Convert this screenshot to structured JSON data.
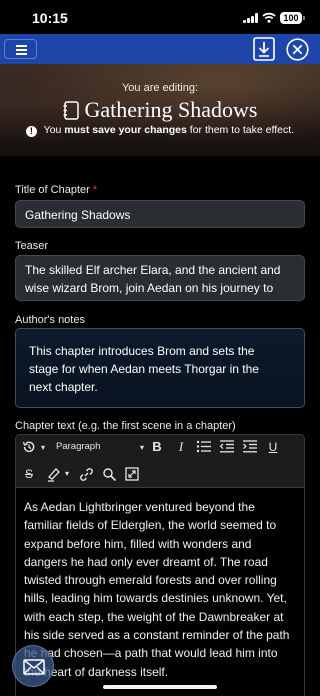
{
  "status": {
    "time": "10:15",
    "battery": "100"
  },
  "toolbar": {
    "menu_icon": "hamburger-menu-icon",
    "download_icon": "download-icon",
    "close_icon": "close-circle-icon"
  },
  "hero": {
    "editing_label": "You are editing:",
    "title": "Gathering Shadows",
    "warning_pre": " You ",
    "warning_bold": "must save your changes",
    "warning_post": " for them to take effect."
  },
  "form": {
    "title_label": "Title of Chapter",
    "title_required_mark": "*",
    "title_value": "Gathering Shadows",
    "teaser_label": "Teaser",
    "teaser_line1": "The skilled Elf archer Elara, and the ancient and",
    "teaser_line2": "wise wizard Brom, join Aedan on his journey to",
    "notes_label": "Author's notes",
    "notes_line1": "This chapter introduces Brom and sets the",
    "notes_line2": "stage for when Aedan meets Thorgar in the",
    "notes_line3": "next chapter.",
    "chapter_label": "Chapter text (e.g. the first scene in a chapter)"
  },
  "editor": {
    "format_value": "Paragraph",
    "bold": "B",
    "italic": "I",
    "underline": "U",
    "strike": "S",
    "lines": [
      "As Aedan Lightbringer ventured beyond the",
      "familiar fields of Elderglen, the world seemed to",
      "expand before him, filled with wonders and",
      "dangers he had only ever dreamt of. The road",
      "twisted through emerald forests and over rolling",
      "hills, leading him towards destinies unknown. Yet,",
      "with each step, the weight of the Dawnbreaker at",
      "his side served as a constant reminder of the path",
      "he had chosen—a path that would lead him into",
      "the heart of darkness itself."
    ]
  },
  "colors": {
    "toolbar": "#1e46a8",
    "required": "#e0404a"
  }
}
